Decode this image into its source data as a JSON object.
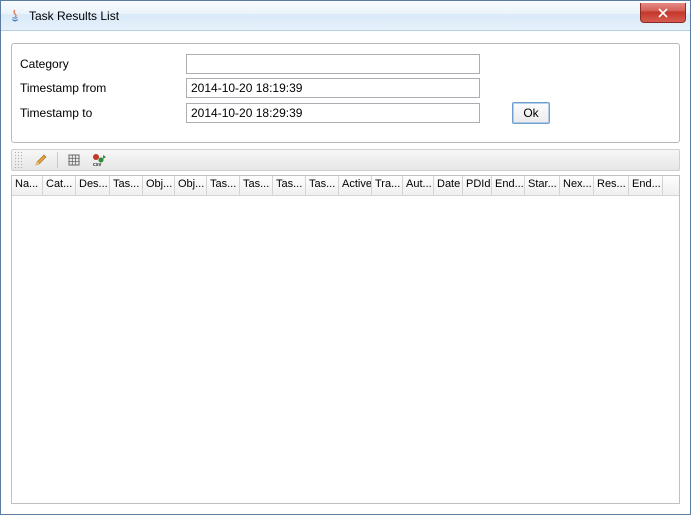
{
  "window": {
    "title": "Task Results List"
  },
  "form": {
    "category_label": "Category",
    "category_value": "",
    "ts_from_label": "Timestamp from",
    "ts_from_value": "2014-10-20 18:19:39",
    "ts_to_label": "Timestamp to",
    "ts_to_value": "2014-10-20 18:29:39",
    "ok_label": "Ok"
  },
  "toolbar": {
    "btn1": "edit-icon",
    "btn2": "grid-icon",
    "btn3": "export-csv-icon"
  },
  "columns": [
    {
      "label": "Na...",
      "w": 31
    },
    {
      "label": "Cat...",
      "w": 33
    },
    {
      "label": "Des...",
      "w": 34
    },
    {
      "label": "Tas...",
      "w": 33
    },
    {
      "label": "Obj...",
      "w": 32
    },
    {
      "label": "Obj...",
      "w": 32
    },
    {
      "label": "Tas...",
      "w": 33
    },
    {
      "label": "Tas...",
      "w": 33
    },
    {
      "label": "Tas...",
      "w": 33
    },
    {
      "label": "Tas...",
      "w": 33
    },
    {
      "label": "Active",
      "w": 33
    },
    {
      "label": "Tra...",
      "w": 31
    },
    {
      "label": "Aut...",
      "w": 31
    },
    {
      "label": "Date",
      "w": 29
    },
    {
      "label": "PDId",
      "w": 29
    },
    {
      "label": "End...",
      "w": 33
    },
    {
      "label": "Star...",
      "w": 35
    },
    {
      "label": "Nex...",
      "w": 34
    },
    {
      "label": "Res...",
      "w": 35
    },
    {
      "label": "End...",
      "w": 34
    }
  ]
}
